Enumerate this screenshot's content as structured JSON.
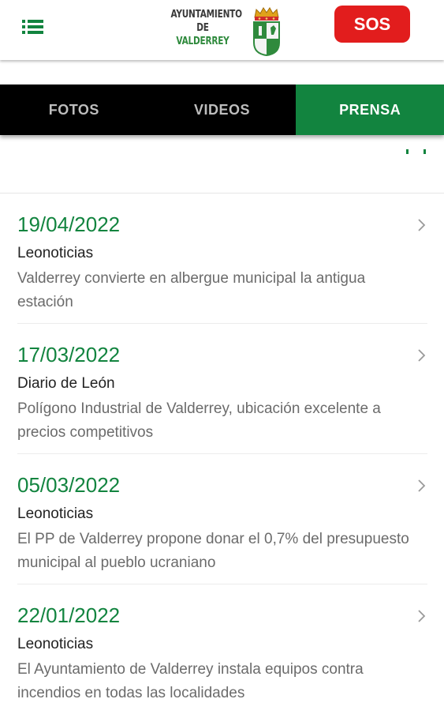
{
  "header": {
    "menu_icon": "hamburger-icon",
    "logo": {
      "line1": "AYUNTAMIENTO",
      "line2": "DE",
      "line3": "VALDERREY",
      "crest_icon": "coat-of-arms-icon"
    },
    "sos_label": "SOS"
  },
  "tabs": [
    {
      "label": "FOTOS",
      "active": false
    },
    {
      "label": "VIDEOS",
      "active": false
    },
    {
      "label": "PRENSA",
      "active": true
    }
  ],
  "news": [
    {
      "date": "19/04/2022",
      "source": "Leonoticias",
      "title": "Valderrey convierte en albergue municipal la antigua estación"
    },
    {
      "date": "17/03/2022",
      "source": "Diario de León",
      "title": "Polígono Industrial de Valderrey, ubicación excelente a precios competitivos"
    },
    {
      "date": "05/03/2022",
      "source": "Leonoticias",
      "title": "El PP de Valderrey propone donar el 0,7% del presupuesto municipal al pueblo ucraniano"
    },
    {
      "date": "22/01/2022",
      "source": "Leonoticias",
      "title": "El Ayuntamiento de Valderrey instala equipos contra incendios en todas las localidades"
    }
  ],
  "colors": {
    "accent_green": "#12843f",
    "sos_red": "#e21d1d",
    "tab_bar": "#000000"
  }
}
